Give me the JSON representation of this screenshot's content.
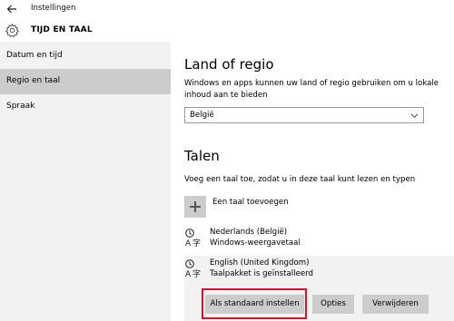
{
  "window": {
    "title": "Instellingen"
  },
  "header": {
    "section_title": "TIJD EN TAAL"
  },
  "sidebar": {
    "items": [
      {
        "label": "Datum en tijd",
        "selected": false
      },
      {
        "label": "Regio en taal",
        "selected": true
      },
      {
        "label": "Spraak",
        "selected": false
      }
    ]
  },
  "region": {
    "heading": "Land of regio",
    "description": "Windows en apps kunnen uw land of regio gebruiken om u lokale inhoud aan te bieden",
    "selected_country": "België"
  },
  "languages": {
    "heading": "Talen",
    "description": "Voeg een taal toe, zodat u in deze taal kunt lezen en typen",
    "add_label": "Een taal toevoegen",
    "items": [
      {
        "name": "Nederlands (België)",
        "status": "Windows-weergavetaal"
      },
      {
        "name": "English (United Kingdom)",
        "status": "Taalpakket is geïnstalleerd"
      }
    ],
    "actions": {
      "set_default": "Als standaard instellen",
      "options": "Opties",
      "remove": "Verwijderen"
    }
  },
  "colors": {
    "highlight": "#e0102a",
    "sidebar_selected": "#cccccc",
    "button_bg": "#cccccc"
  },
  "icons": [
    "back-arrow-icon",
    "gear-icon",
    "chevron-down-icon",
    "plus-icon",
    "language-icon"
  ]
}
